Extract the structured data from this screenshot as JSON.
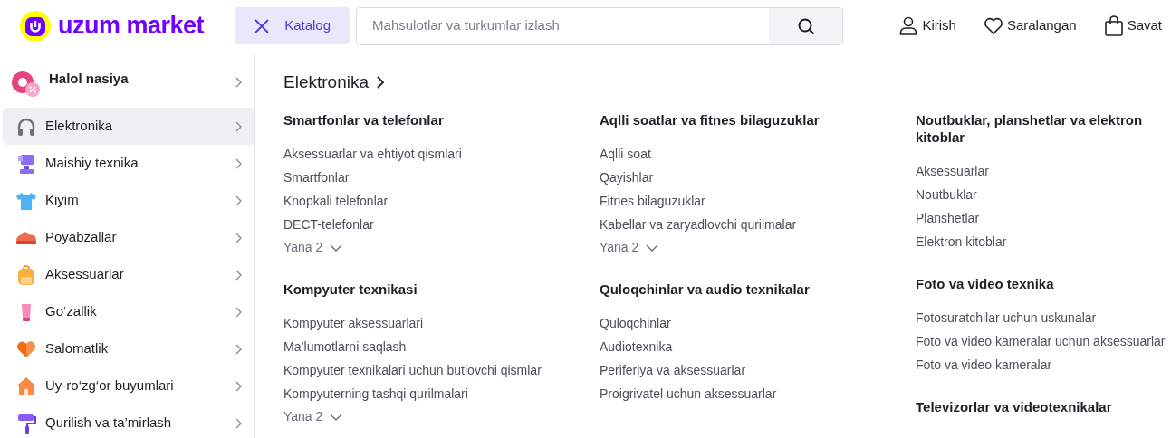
{
  "header": {
    "logo": "uzum market",
    "catalog_button": "Katalog",
    "search": {
      "placeholder": "Mahsulotlar va turkumlar izlash"
    },
    "actions": [
      {
        "kind": "user",
        "label": "Kirish"
      },
      {
        "kind": "heart",
        "label": "Saralangan"
      },
      {
        "kind": "bag",
        "label": "Savat"
      }
    ]
  },
  "sidebar": {
    "items": [
      {
        "kind": "promo",
        "label": "Halol nasiya",
        "selected": false
      },
      {
        "kind": "category",
        "label": "Elektronika",
        "selected": true
      },
      {
        "kind": "category",
        "label": "Maishiy texnika",
        "selected": false
      },
      {
        "kind": "category",
        "label": "Kiyim",
        "selected": false
      },
      {
        "kind": "category",
        "label": "Poyabzallar",
        "selected": false
      },
      {
        "kind": "category",
        "label": "Aksessuarlar",
        "selected": false
      },
      {
        "kind": "category",
        "label": "Go‘zallik",
        "selected": false
      },
      {
        "kind": "category",
        "label": "Salomatlik",
        "selected": false
      },
      {
        "kind": "category",
        "label": "Uy-ro‘zg‘or buyumlari",
        "selected": false
      },
      {
        "kind": "category",
        "label": "Qurilish va ta’mirlash",
        "selected": false
      }
    ]
  },
  "content": {
    "title": "Elektronika",
    "columns": [
      {
        "groups": [
          {
            "title": "Smartfonlar va telefonlar",
            "links": [
              "Aksessuarlar va ehtiyot qismlari",
              "Smartfonlar",
              "Knopkali telefonlar",
              "DECT-telefonlar"
            ],
            "more": "Yana 2"
          },
          {
            "title": "Kompyuter texnikasi",
            "links": [
              "Kompyuter aksessuarlari",
              "Ma’lumotlarni saqlash",
              "Kompyuter texnikalari uchun butlovchi qismlar",
              "Kompyuterning tashqi qurilmalari"
            ],
            "more": "Yana 2"
          }
        ]
      },
      {
        "groups": [
          {
            "title": "Aqlli soatlar va fitnes bilaguzuklar",
            "links": [
              "Aqlli soat",
              "Qayishlar",
              "Fitnes bilaguzuklar",
              "Kabellar va zaryadlovchi qurilmalar"
            ],
            "more": "Yana 2"
          },
          {
            "title": "Quloqchinlar va audio texnikalar",
            "links": [
              "Quloqchinlar",
              "Audiotexnika",
              "Periferiya va aksessuarlar",
              "Proigrivatel uchun aksessuarlar"
            ]
          }
        ]
      },
      {
        "groups": [
          {
            "title": "Noutbuklar, planshetlar va elektron kitoblar",
            "links": [
              "Aksessuarlar",
              "Noutbuklar",
              "Planshetlar",
              "Elektron kitoblar"
            ]
          },
          {
            "title": "Foto va video texnika",
            "links": [
              "Fotosuratchilar uchun uskunalar",
              "Foto va video kameralar uchun aksessuarlar",
              "Foto va video kameralar"
            ]
          },
          {
            "title": "Televizorlar va videotexnikalar"
          }
        ]
      }
    ]
  }
}
